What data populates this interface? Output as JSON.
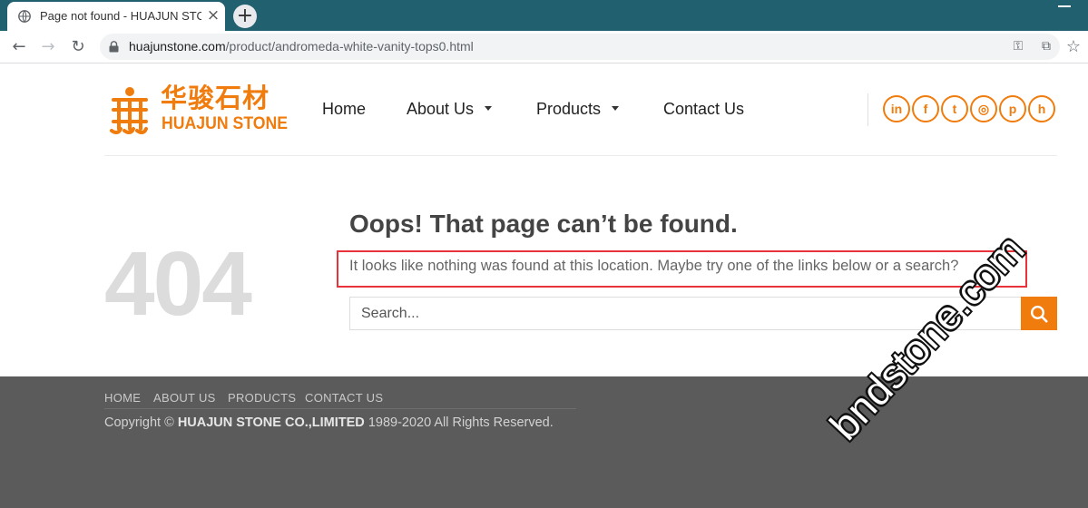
{
  "browser": {
    "tab_title": "Page not found - HUAJUN STONE CO.,LIMITED",
    "tab_close": "×",
    "new_tab": "+",
    "url_host": "huajunstone.com",
    "url_path": "/product/andromeda-white-vanity-tops0.html"
  },
  "header": {
    "logo_cn": "华骏石材",
    "logo_en": "HUAJUN STONE",
    "nav": [
      {
        "label": "Home"
      },
      {
        "label": "About Us",
        "has_dropdown": true
      },
      {
        "label": "Products",
        "has_dropdown": true
      },
      {
        "label": "Contact Us"
      }
    ],
    "social": [
      {
        "icon": "linkedin-icon",
        "glyph": "in"
      },
      {
        "icon": "facebook-icon",
        "glyph": "f"
      },
      {
        "icon": "twitter-icon",
        "glyph": "t"
      },
      {
        "icon": "instagram-icon",
        "glyph": "◎"
      },
      {
        "icon": "pinterest-icon",
        "glyph": "p"
      },
      {
        "icon": "houzz-icon",
        "glyph": "h"
      }
    ]
  },
  "error": {
    "code": "404",
    "title": "Oops! That page can’t be found.",
    "message": "It looks like nothing was found at this location. Maybe try one of the links below or a search?",
    "search_placeholder": "Search..."
  },
  "footer": {
    "nav": [
      "HOME",
      "ABOUT US",
      "PRODUCTS",
      "CONTACT US"
    ],
    "copyright_prefix": "Copyright ©",
    "company": "HUAJUN STONE CO.,LIMITED",
    "copyright_suffix": "1989-2020 All Rights Reserved."
  },
  "watermark": "bndstone.com",
  "colors": {
    "brand_orange": "#f07c0e",
    "tabbar": "#21606f",
    "footer_bg": "#5b5b5b",
    "highlight_red": "#e8323c"
  }
}
